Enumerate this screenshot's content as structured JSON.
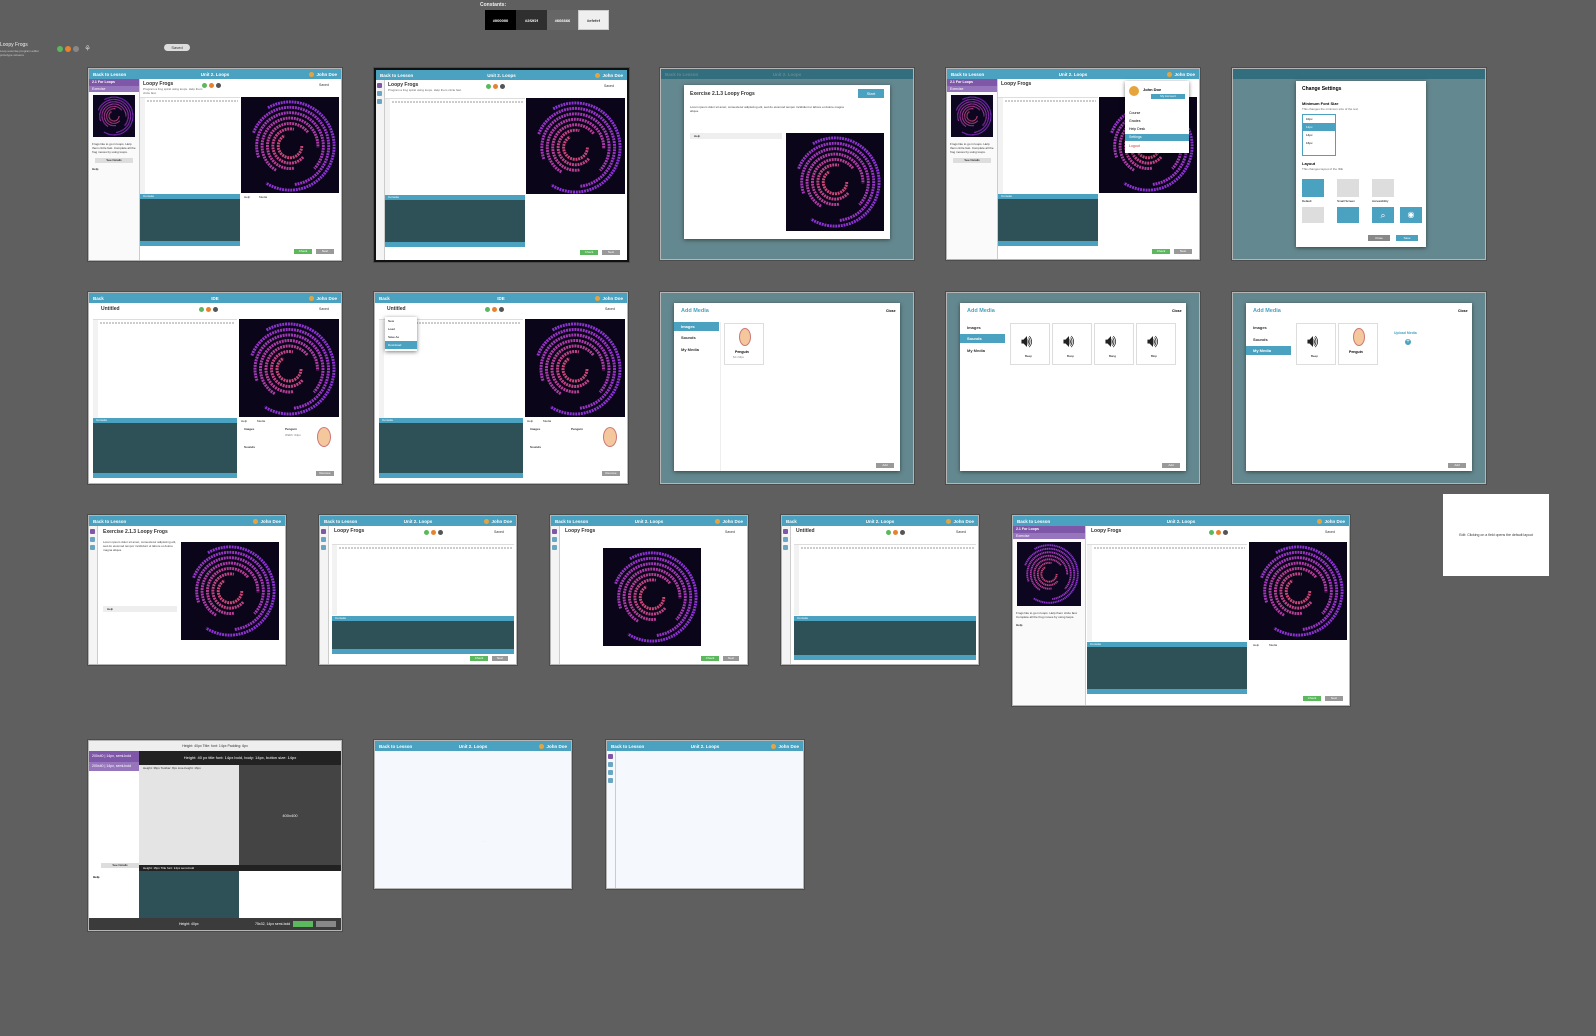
{
  "legend": {
    "title": "Constants:",
    "swatches": [
      {
        "label": "#000000",
        "bg": "#000000",
        "fg": "#ffffff"
      },
      {
        "label": "#2f2f2f",
        "bg": "#2f2f2f",
        "fg": "#ffffff"
      },
      {
        "label": "#666666",
        "bg": "#666666",
        "fg": "#ffffff"
      },
      {
        "label": "#efefef",
        "bg": "#efefef",
        "fg": "#333333"
      }
    ]
  },
  "app": {
    "name": "Loopy Frogs",
    "subtitle": "Loop exercise program editor prototype screens",
    "saved_chip": "Saved"
  },
  "colors": {
    "header": "#4ba2c0",
    "sidebar_accent": "#7e57a8",
    "console": "#2d5157",
    "run": "#5bb85c",
    "background": "#5f5f5f"
  },
  "common": {
    "back_to_lesson": "Back to Lesson",
    "back": "Back",
    "unit_title": "Unit 2. Loops",
    "ide_title": "IDE",
    "user": "John Doe",
    "sidebar_unit": "2.1 For Loops",
    "sidebar_exercise": "Exercise",
    "editor_title": "Loopy Frogs",
    "editor_title_untitled": "Untitled",
    "editor_sub": "Program a frog spiral using loops. Help them circle fast.",
    "saved": "Saved",
    "console": "Console",
    "clear": "Clear",
    "help": "Help",
    "media": "Media",
    "check": "Check",
    "next": "Next",
    "see_details": "See Details",
    "sidebar_text": "Frogs like to go in loops. Help them circle fast. Complete all the frog moves by using loops.",
    "toolbar_items": [
      "New",
      "Load",
      "Save",
      "Screen",
      "Export",
      "Undo"
    ]
  },
  "start_modal": {
    "title": "Exercise 2.1.3 Loopy Frogs",
    "start_button": "Start",
    "body": "Lorem ipsum dolor sit amet, consectetur adipiscing elit, sed do eiusmod tempor incididunt ut labore et dolore magna aliqua.",
    "help": "Help"
  },
  "account_menu": {
    "name": "John Doe",
    "my_account": "My Account",
    "items": [
      "Course",
      "Grades",
      "Help Desk",
      "Settings",
      "Logout"
    ],
    "active": "Settings"
  },
  "settings_modal": {
    "title": "Change Settings",
    "font_label": "Minimum Font Size",
    "font_desc": "This changes the minimum size of the text",
    "font_options": [
      "10px",
      "12px",
      "14px",
      "16px"
    ],
    "font_selected": "12px",
    "layout_label": "Layout",
    "layout_desc": "This changes layout of the IDE",
    "layouts": [
      "Default",
      "Small Screen",
      "Accessibility"
    ],
    "close": "Close",
    "save": "Save"
  },
  "file_menu": {
    "items": [
      "New",
      "Load",
      "Save As",
      "Download"
    ],
    "active": "Download"
  },
  "media_panel": {
    "images": "Images",
    "sounds": "Sounds",
    "item_name": "Penguin",
    "item_meta": "Width: 64px",
    "remove": "Remove"
  },
  "add_media": {
    "title": "Add Media",
    "close": "Close",
    "nav": [
      "Images",
      "Sounds",
      "My Media"
    ],
    "add": "Add",
    "image_name": "Penguin",
    "image_meta": "64 x 64px",
    "sound_names": [
      "Beep",
      "Boop",
      "Bang",
      "Blop"
    ],
    "upload": "Upload Media"
  },
  "spec_frame": {
    "top_note": "Height: 40px  Title: font: 14px  Padding: 6px",
    "purple_row1": "200x40 | 14px, semi-bold",
    "purple_row2": "200x40 | 14px, semi-bold",
    "dark_bar": "Height: 40 px title font: 14px bold, body: 14px, button size: 14px",
    "sub_note": "Height: 36px  Toolbar: 8px  Line-height: 16px",
    "canvas_label": "400x400",
    "console_note": "Height: 16px  Title font: 14px semi-bold",
    "footer_note": "Height: 40px",
    "footer_note2": "75x32, 14px semi-bold"
  },
  "note_card": "Edit: Clicking on a field opens the default layout",
  "blank_text": "..."
}
